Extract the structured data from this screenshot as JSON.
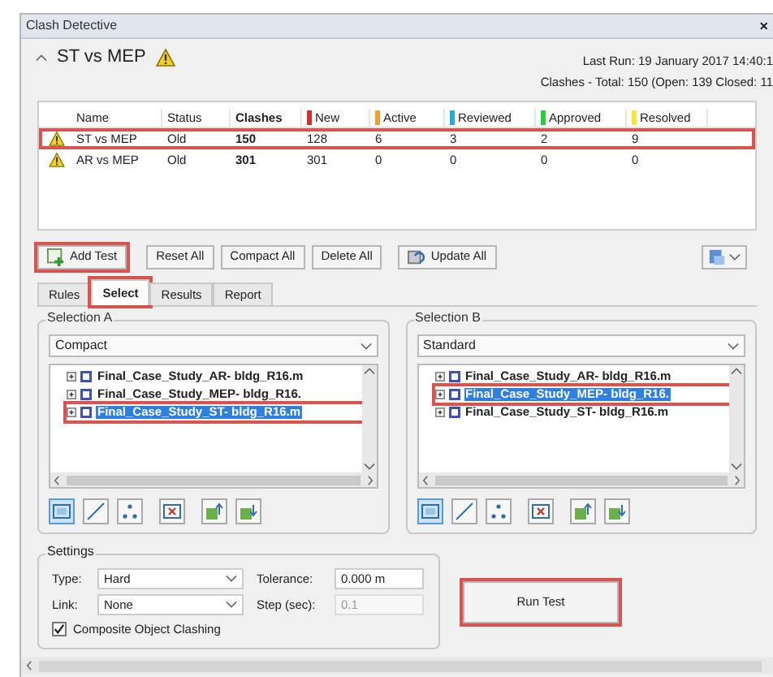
{
  "window": {
    "title": "Clash Detective",
    "close": "×"
  },
  "test_header": {
    "expanded": true,
    "name": "ST vs MEP",
    "last_run": "Last Run:  19 January 2017 14:40:1",
    "clashes_summary": "Clashes - Total: 150 (Open: 139  Closed: 11"
  },
  "table": {
    "columns": [
      {
        "label": "Name"
      },
      {
        "label": "Status"
      },
      {
        "label": "Clashes"
      },
      {
        "label": "New",
        "color": "#d32f2f"
      },
      {
        "label": "Active",
        "color": "#f0a030"
      },
      {
        "label": "Reviewed",
        "color": "#29a8e0"
      },
      {
        "label": "Approved",
        "color": "#2ecc40"
      },
      {
        "label": "Resolved",
        "color": "#f5e642"
      }
    ],
    "rows": [
      {
        "highlighted": true,
        "cells": [
          "ST vs MEP",
          "Old",
          "150",
          "128",
          "6",
          "3",
          "2",
          "9"
        ]
      },
      {
        "highlighted": false,
        "cells": [
          "AR vs MEP",
          "Old",
          "301",
          "301",
          "0",
          "0",
          "0",
          "0"
        ]
      }
    ]
  },
  "toolbar": {
    "buttons": [
      {
        "label": "Add Test",
        "kind": "add",
        "highlighted": true
      },
      {
        "label": "Reset All",
        "kind": "plain",
        "highlighted": false
      },
      {
        "label": "Compact All",
        "kind": "plain",
        "highlighted": false
      },
      {
        "label": "Delete All",
        "kind": "plain",
        "highlighted": false
      },
      {
        "label": "Update All",
        "kind": "update",
        "highlighted": false
      }
    ]
  },
  "tabs": [
    {
      "label": "Rules",
      "selected": false,
      "highlighted": false
    },
    {
      "label": "Select",
      "selected": true,
      "highlighted": true
    },
    {
      "label": "Results",
      "selected": false,
      "highlighted": false
    },
    {
      "label": "Report",
      "selected": false,
      "highlighted": false
    }
  ],
  "selections": [
    {
      "title": "Selection A",
      "dropdown": "Compact",
      "items": [
        {
          "label": "Final_Case_Study_AR- bldg_R16.m",
          "selected": false,
          "highlighted": false
        },
        {
          "label": "Final_Case_Study_MEP- bldg_R16.",
          "selected": false,
          "highlighted": false
        },
        {
          "label": "Final_Case_Study_ST- bldg_R16.m",
          "selected": true,
          "highlighted": true
        }
      ],
      "tools": [
        {
          "kind": "surfaces",
          "selected": true
        },
        {
          "kind": "lines",
          "selected": false
        },
        {
          "kind": "points",
          "selected": false
        },
        {
          "kind": "self",
          "selected": false
        },
        {
          "kind": "use-current",
          "selected": false
        },
        {
          "kind": "select-current",
          "selected": false
        }
      ]
    },
    {
      "title": "Selection B",
      "dropdown": "Standard",
      "items": [
        {
          "label": "Final_Case_Study_AR- bldg_R16.m",
          "selected": false,
          "highlighted": false
        },
        {
          "label": "Final_Case_Study_MEP- bldg_R16.",
          "selected": true,
          "highlighted": true
        },
        {
          "label": "Final_Case_Study_ST- bldg_R16.m",
          "selected": false,
          "highlighted": false
        }
      ],
      "tools": [
        {
          "kind": "surfaces",
          "selected": true
        },
        {
          "kind": "lines",
          "selected": false
        },
        {
          "kind": "points",
          "selected": false
        },
        {
          "kind": "self",
          "selected": false
        },
        {
          "kind": "use-current",
          "selected": false
        },
        {
          "kind": "select-current",
          "selected": false
        }
      ]
    }
  ],
  "settings": {
    "title": "Settings",
    "type_label": "Type:",
    "type_value": "Hard",
    "tolerance_label": "Tolerance:",
    "tolerance_value": "0.000 m",
    "link_label": "Link:",
    "link_value": "None",
    "step_label": "Step (sec):",
    "step_value": "0.1",
    "composite_label": "Composite Object Clashing",
    "composite_checked": true
  },
  "run_button": {
    "label": "Run Test",
    "highlighted": true
  }
}
